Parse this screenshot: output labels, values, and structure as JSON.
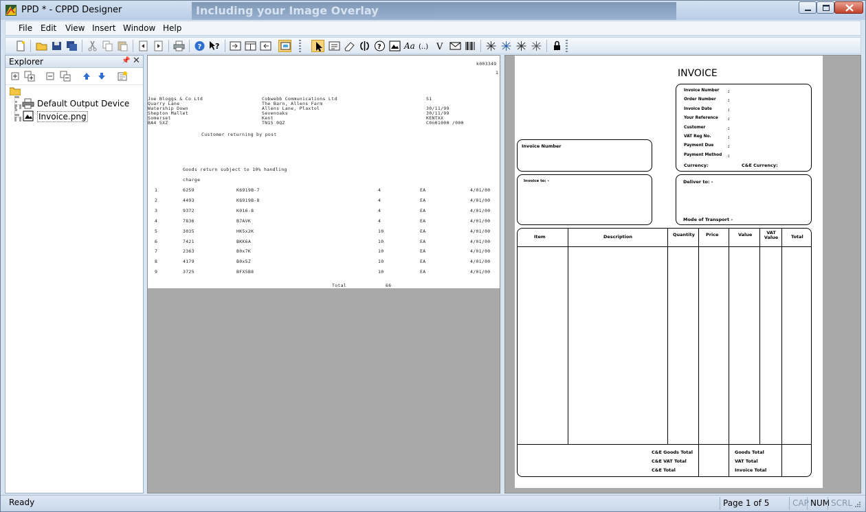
{
  "window": {
    "title": "PPD * - CPPD Designer",
    "ghost_title": "Including your Image Overlay"
  },
  "menu": [
    "File",
    "Edit",
    "View",
    "Insert",
    "Window",
    "Help"
  ],
  "toolbar_icons": [
    "new-icon",
    "open-icon",
    "save-icon",
    "save-all-icon",
    "cut-icon",
    "copy-icon",
    "paste-icon",
    "prev-page-icon",
    "next-page-icon",
    "print-icon",
    "help-icon",
    "context-help-icon",
    "indent-icon",
    "columns-icon",
    "outdent-icon",
    "overlay-icon",
    "pointer-icon",
    "text-field-icon",
    "eraser-icon",
    "link-icon",
    "question-icon",
    "image-icon",
    "font-icon",
    "bracket-icon",
    "v-icon",
    "envelope-icon",
    "barcode-icon",
    "star-icon",
    "star-icon",
    "star-icon",
    "star-icon",
    "lock-icon"
  ],
  "explorer": {
    "title": "Explorer",
    "items": [
      {
        "label": "Default Output Device",
        "icon": "printer-icon"
      },
      {
        "label": "Invoice.png",
        "icon": "image-file-icon"
      }
    ]
  },
  "print_doc": {
    "ref": "k003349",
    "page": "1",
    "from": [
      "Joe Bloggs & Co Ltd",
      "Quarry Lane",
      "Watership Down",
      "Shepton Mallet",
      "Somerset",
      "BA4 5XZ"
    ],
    "to": [
      "Cobwebb Communications Ltd",
      "The Barn, Allens Farm",
      "Allens Lane, Plaxtol",
      "Sevenoaks",
      "Kent",
      "TN15 0QZ"
    ],
    "meta": [
      "S1",
      "30/11/99",
      "30/11/99",
      "KENTXX",
      "C0n01000 /000"
    ],
    "note1": "Customer returning by post",
    "note2": "Goods return subject to 10% handling",
    "note3": "charge",
    "rows": [
      [
        "1",
        "6259",
        "K6919B-7",
        "4",
        "EA",
        "4/01/00"
      ],
      [
        "2",
        "4493",
        "K6919B-8",
        "4",
        "EA",
        "4/01/00"
      ],
      [
        "3",
        "9372",
        "K016-8",
        "4",
        "EA",
        "4/01/00"
      ],
      [
        "4",
        "7836",
        "B7AVK",
        "4",
        "EA",
        "4/01/00"
      ],
      [
        "5",
        "3035",
        "HK5x2K",
        "10",
        "EA",
        "4/01/00"
      ],
      [
        "6",
        "7421",
        "BKK6A",
        "10",
        "EA",
        "4/01/00"
      ],
      [
        "7",
        "2363",
        "B0x7K",
        "10",
        "EA",
        "4/01/00"
      ],
      [
        "8",
        "4179",
        "B0x5Z",
        "10",
        "EA",
        "4/01/00"
      ],
      [
        "9",
        "3725",
        "BFX5B8",
        "10",
        "EA",
        "4/01/00"
      ]
    ],
    "total_label": "Total",
    "total_value": "66"
  },
  "invoice": {
    "title": "INVOICE",
    "info_labels": [
      "Invoice Number",
      "Order Number",
      "Invoice Date",
      "Your Reference",
      "Customer",
      "VAT Reg No.",
      "Payment Due",
      "Payment Method"
    ],
    "colon": ":",
    "currency": "Currency:",
    "cie_currency": "C&E Currency:",
    "invoice_number": "Invoice Number",
    "invoice_to": "Invoice to: -",
    "deliver_to": "Deliver to: -",
    "mode_of_transport": "Mode of Transport -",
    "columns": [
      "Item",
      "Description",
      "Quantity",
      "Price",
      "Value",
      "VAT Value",
      "Total"
    ],
    "foot_left": [
      "C&E Goods Total",
      "C&E VAT Total",
      "C&E Total"
    ],
    "foot_right": [
      "Goods Total",
      "VAT Total",
      "Invoice Total"
    ]
  },
  "status": {
    "ready": "Ready",
    "page": "Page 1 of 5",
    "cap": "CAP",
    "num": "NUM",
    "scrl": "SCRL"
  }
}
